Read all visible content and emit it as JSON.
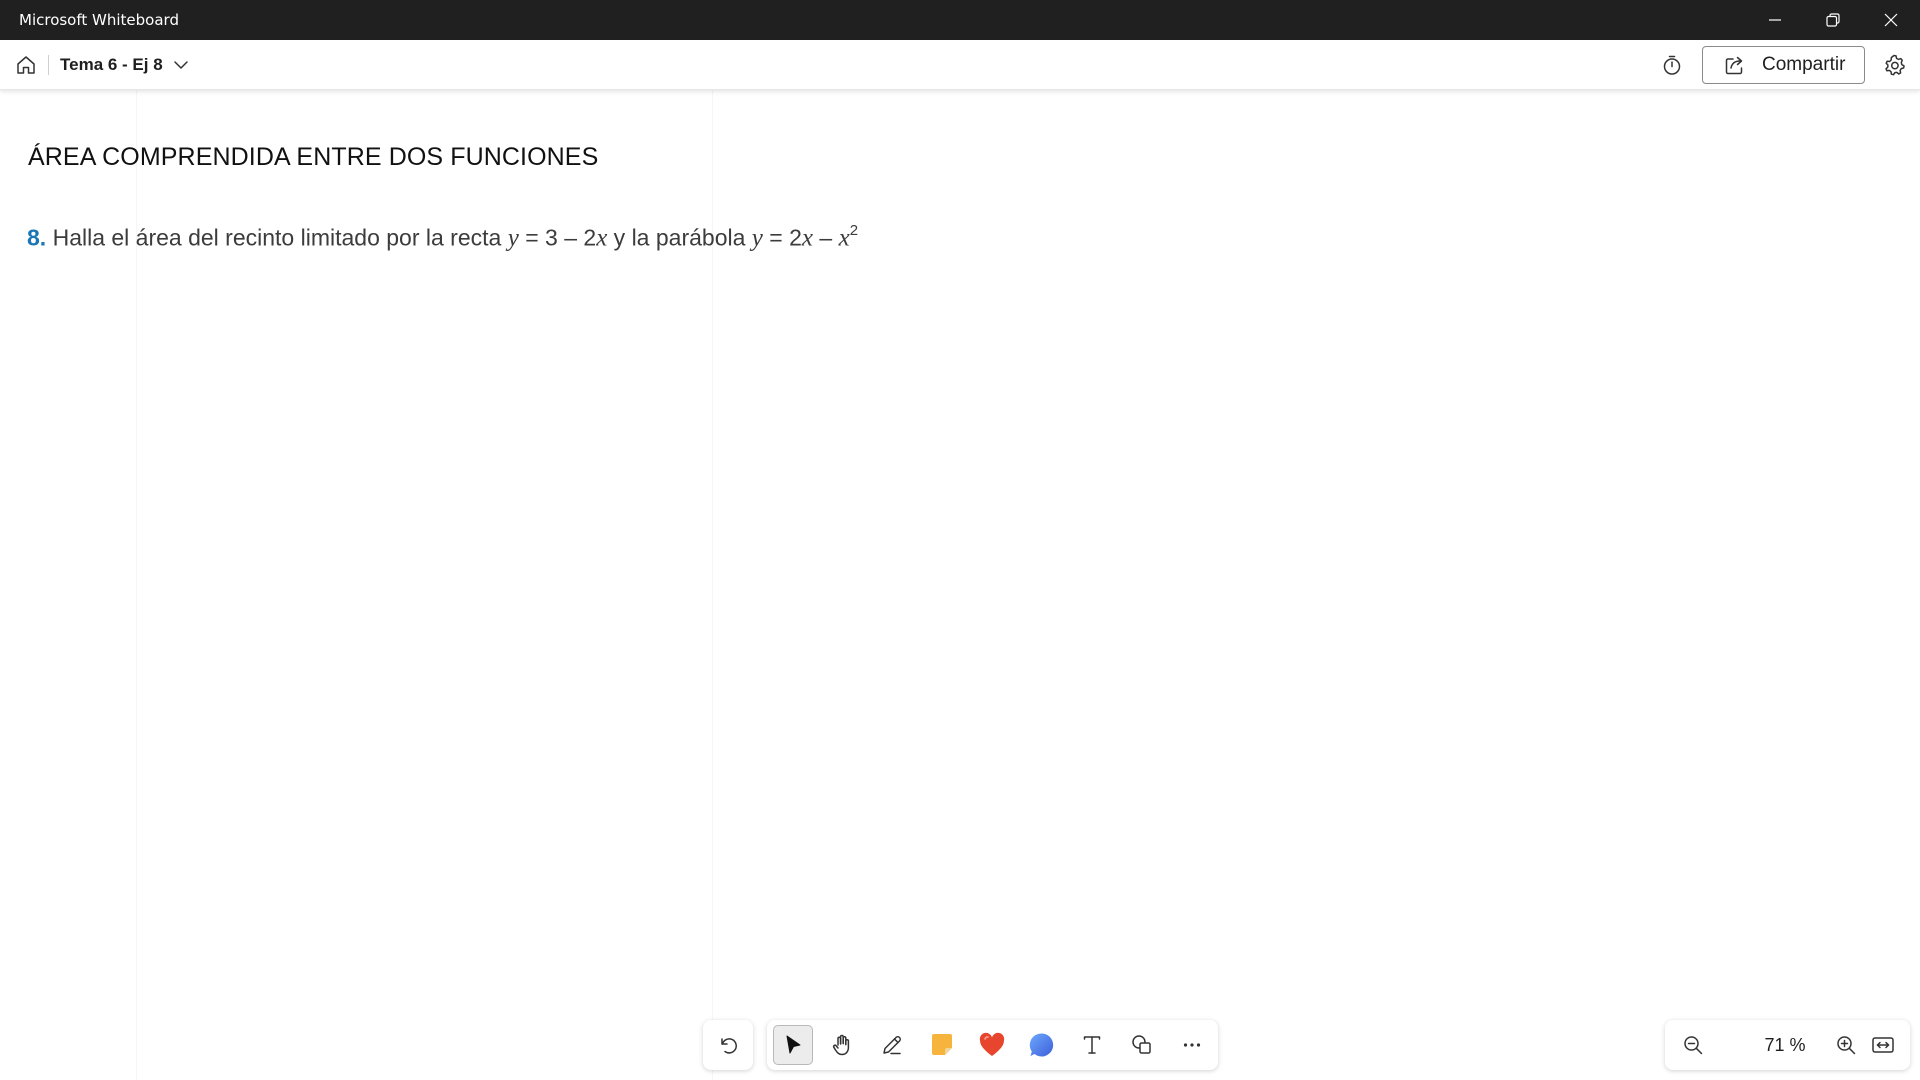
{
  "window": {
    "title": "Microsoft Whiteboard"
  },
  "header": {
    "board_title": "Tema 6 - Ej 8",
    "share_label": "Compartir"
  },
  "canvas": {
    "heading": "ÁREA COMPRENDIDA ENTRE DOS FUNCIONES",
    "problem": {
      "number": "8.",
      "text_a": "Halla el área del recinto limitado por la recta ",
      "var_y1": "y",
      "text_b": " = 3 – 2",
      "var_x1": "x",
      "text_c": " y la parábola ",
      "var_y2": "y",
      "text_d": " = 2",
      "var_x2": "x",
      "text_e": " – ",
      "var_x3": "x",
      "exponent": "2"
    }
  },
  "toolbar": {
    "tools": [
      "undo-icon",
      "select-icon",
      "hand-icon",
      "pen-icon",
      "sticky-note-icon",
      "reactions-icon",
      "comment-icon",
      "text-icon",
      "shapes-icon",
      "more-icon"
    ],
    "active_tool": "select"
  },
  "zoom": {
    "level": "71 %"
  },
  "colors": {
    "titlebar": "#202020",
    "problem_number": "#1b76b5",
    "sticky": "#f6b43c",
    "heart": "#e8452f",
    "comment": "#4a7ee8"
  }
}
